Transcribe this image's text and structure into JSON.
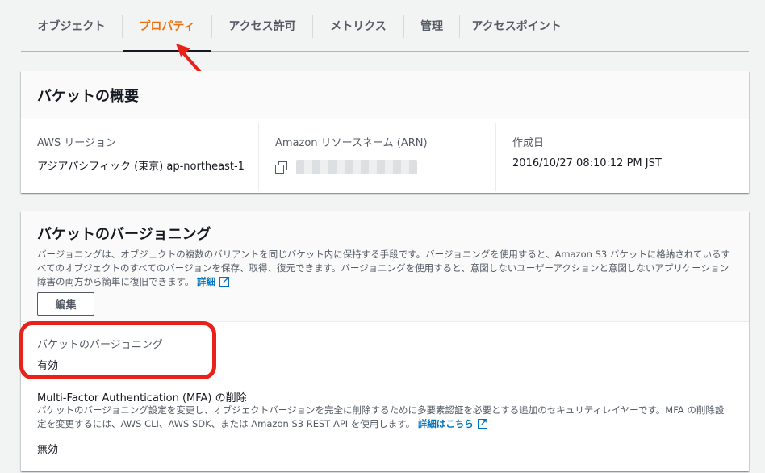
{
  "tabs": [
    {
      "label": "オブジェクト"
    },
    {
      "label": "プロパティ"
    },
    {
      "label": "アクセス許可"
    },
    {
      "label": "メトリクス"
    },
    {
      "label": "管理"
    },
    {
      "label": "アクセスポイント"
    }
  ],
  "colors": {
    "accent": "#ec7211",
    "link": "#0073bb",
    "highlight": "#e8221b"
  },
  "overview": {
    "title": "バケットの概要",
    "region_label": "AWS リージョン",
    "region_value": "アジアパシフィック (東京) ap-northeast-1",
    "arn_label": "Amazon リソースネーム (ARN)",
    "created_label": "作成日",
    "created_value": "2016/10/27 08:10:12 PM JST"
  },
  "versioning": {
    "title": "バケットのバージョニング",
    "description": "バージョニングは、オブジェクトの複数のバリアントを同じバケット内に保持する手段です。バージョニングを使用すると、Amazon S3 バケットに格納されているすべてのオブジェクトのすべてのバージョンを保存、取得、復元できます。バージョニングを使用すると、意図しないユーザーアクションと意図しないアプリケーション障害の両方から簡単に復旧できます。",
    "details_link": "詳細",
    "edit_button": "編集",
    "status_label": "バケットのバージョニング",
    "status_value": "有効",
    "mfa_title": "Multi-Factor Authentication (MFA) の削除",
    "mfa_description": "バケットのバージョニング設定を変更し、オブジェクトバージョンを完全に削除するために多要素認証を必要とする追加のセキュリティレイヤーです。MFA の削除設定を変更するには、AWS CLI、AWS SDK、または Amazon S3 REST API を使用します。",
    "mfa_link": "詳細はこちら",
    "mfa_value": "無効"
  }
}
